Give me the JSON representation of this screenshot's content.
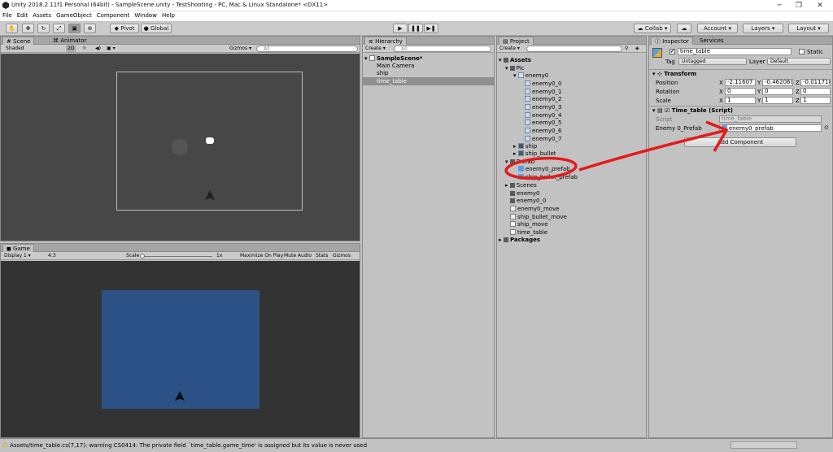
{
  "window": {
    "title": "Unity 2018.2.11f1 Personal (64bit) - SampleScene.unity - TestShooting - PC, Mac & Linux Standalone* <DX11>"
  },
  "menu": [
    "File",
    "Edit",
    "Assets",
    "GameObject",
    "Component",
    "Window",
    "Help"
  ],
  "toolbar": {
    "pivot": "Pivot",
    "global": "Global",
    "collab": "Collab",
    "account": "Account",
    "layers": "Layers",
    "layout": "Layout"
  },
  "scene": {
    "tab_scene": "Scene",
    "tab_animator": "Animator",
    "shading": "Shaded",
    "mode2d": "2D",
    "gizmos": "Gizmos",
    "search_placeholder": "All"
  },
  "game": {
    "tab": "Game",
    "display": "Display 1",
    "aspect": "4:3",
    "scale_label": "Scale",
    "scale_value": "1x",
    "maximize": "Maximize On Play",
    "mute": "Mute Audio",
    "stats": "Stats",
    "gizmos": "Gizmos"
  },
  "hierarchy": {
    "tab": "Hierarchy",
    "create": "Create",
    "search_placeholder": "All",
    "scene": "SampleScene*",
    "items": [
      "Main Camera",
      "ship",
      "time_table"
    ],
    "selected": "time_table"
  },
  "project": {
    "tab": "Project",
    "create": "Create",
    "assets": "Assets",
    "pic": "Pic",
    "enemy0_folder": "enemy0",
    "sprites": [
      "enemy0_0",
      "enemy0_1",
      "enemy0_2",
      "enemy0_3",
      "enemy0_4",
      "enemy0_5",
      "enemy0_6",
      "enemy0_7"
    ],
    "ship": "ship",
    "ship_bullet": "ship_bullet",
    "prefab_folder": "Prefab",
    "prefabs": [
      "enemy0_prefab",
      "ship_bullet_prefab"
    ],
    "scenes": "Scenes",
    "files": [
      "enemy0",
      "enemy0_0",
      "enemy0_move",
      "ship_bullet_move",
      "ship_move",
      "time_table"
    ],
    "packages": "Packages"
  },
  "inspector": {
    "tab_inspector": "Inspector",
    "tab_services": "Services",
    "object_name": "time_table",
    "static": "Static",
    "tag_label": "Tag",
    "tag": "Untagged",
    "layer_label": "Layer",
    "layer": "Default",
    "transform": {
      "title": "Transform",
      "position": "Position",
      "rotation": "Rotation",
      "scale": "Scale",
      "pos": [
        "-2.11607",
        "-0.462060",
        "-0.011718"
      ],
      "rot": [
        "0",
        "0",
        "0"
      ],
      "scl": [
        "1",
        "1",
        "1"
      ],
      "axes": [
        "X",
        "Y",
        "Z"
      ]
    },
    "script": {
      "title": "Time_table (Script)",
      "script_label": "Script",
      "script_value": "time_table",
      "field_label": "Enemy 0_Prefab",
      "field_value": "enemy0_prefab"
    },
    "add_component": "Add Component"
  },
  "status": {
    "message": "Assets/time_table.cs(7,17): warning CS0414: The private field `time_table.game_time' is assigned but its value is never used"
  },
  "colors": {
    "game_bg": "#2c5186",
    "scene_bg": "#474747",
    "game_view_bg": "#333333",
    "annotation": "#e51a1a"
  }
}
